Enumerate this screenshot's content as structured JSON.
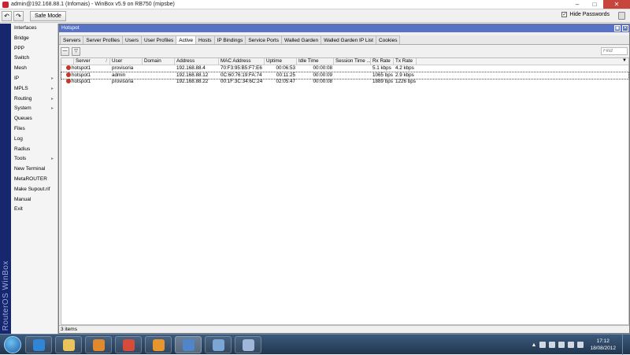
{
  "window": {
    "title": "admin@192.168.88.1 (Infomais) - WinBox v5.9 on RB750 (mipsbe)",
    "buttons": [
      "–",
      "□",
      "✕"
    ]
  },
  "toolbar": {
    "undo_glyph": "↶",
    "redo_glyph": "↷",
    "safe_mode_label": "Safe Mode",
    "hide_passwords_label": "Hide Passwords",
    "hide_passwords_checked": true,
    "check_glyph": "✓"
  },
  "sidebar": {
    "brand": "RouterOS WinBox",
    "items": [
      {
        "label": "Interfaces",
        "arrow": ""
      },
      {
        "label": "Bridge",
        "arrow": ""
      },
      {
        "label": "PPP",
        "arrow": ""
      },
      {
        "label": "Switch",
        "arrow": ""
      },
      {
        "label": "Mesh",
        "arrow": ""
      },
      {
        "label": "IP",
        "arrow": "▸"
      },
      {
        "label": "MPLS",
        "arrow": "▸"
      },
      {
        "label": "Routing",
        "arrow": "▸"
      },
      {
        "label": "System",
        "arrow": "▸"
      },
      {
        "label": "Queues",
        "arrow": ""
      },
      {
        "label": "Files",
        "arrow": ""
      },
      {
        "label": "Log",
        "arrow": ""
      },
      {
        "label": "Radius",
        "arrow": ""
      },
      {
        "label": "Tools",
        "arrow": "▸"
      },
      {
        "label": "New Terminal",
        "arrow": ""
      },
      {
        "label": "MetaROUTER",
        "arrow": ""
      },
      {
        "label": "Make Supout.rif",
        "arrow": ""
      },
      {
        "label": "Manual",
        "arrow": ""
      },
      {
        "label": "Exit",
        "arrow": ""
      }
    ]
  },
  "panel": {
    "title": "Hotspot",
    "restore_glyph": "▣",
    "close_glyph": "✕",
    "tabs": [
      "Servers",
      "Server Profiles",
      "Users",
      "User Profiles",
      "Active",
      "Hosts",
      "IP Bindings",
      "Service Ports",
      "Walled Garden",
      "Walled Garden IP List",
      "Cookies"
    ],
    "active_tab": 4,
    "remove_glyph": "—",
    "filter_glyph": "▽",
    "find_placeholder": "Find",
    "more_glyph": "▼",
    "columns": [
      "Server",
      "User",
      "Domain",
      "Address",
      "MAC Address",
      "Uptime",
      "Idle Time",
      "Session Time ...",
      "Rx Rate",
      "Tx Rate"
    ],
    "sort_glyph": "/",
    "rows": [
      {
        "server": "hotspot1",
        "user": "provisoria",
        "domain": "",
        "address": "192.168.88.4",
        "mac": "70:F3:95:B5:F7:E6",
        "uptime": "00:06:53",
        "idle": "00:00:08",
        "session": "",
        "rx": "5.1 kbps",
        "tx": "4.2 kbps"
      },
      {
        "server": "hotspot1",
        "user": "admin",
        "domain": "",
        "address": "192.168.88.12",
        "mac": "0C:60:76:19:FA:74",
        "uptime": "00:11:25",
        "idle": "00:00:09",
        "session": "",
        "rx": "1065 bps",
        "tx": "2.9 kbps"
      },
      {
        "server": "hotspot1",
        "user": "provisoria",
        "domain": "",
        "address": "192.168.88.22",
        "mac": "00:1F:3C:34:6C:24",
        "uptime": "02:05:47",
        "idle": "00:00:08",
        "session": "",
        "rx": "1889 bps",
        "tx": "1226 bps"
      }
    ],
    "status": "3 items"
  },
  "taskbar": {
    "apps": [
      {
        "icon": "internet-explorer-icon",
        "color": "#2f86d6"
      },
      {
        "icon": "file-explorer-icon",
        "color": "#e8c45a"
      },
      {
        "icon": "media-player-icon",
        "color": "#e28a2b"
      },
      {
        "icon": "chrome-icon",
        "color": "#d64b3a"
      },
      {
        "icon": "outlook-icon",
        "color": "#e9952e"
      },
      {
        "icon": "winbox-icon",
        "color": "#4e86c9"
      },
      {
        "icon": "network-icon",
        "color": "#7aa6d6"
      },
      {
        "icon": "paint-icon",
        "color": "#9fb7d9"
      }
    ],
    "active_app": 5,
    "tray_up": "▲",
    "time": "17:12",
    "date": "18/08/2012"
  }
}
